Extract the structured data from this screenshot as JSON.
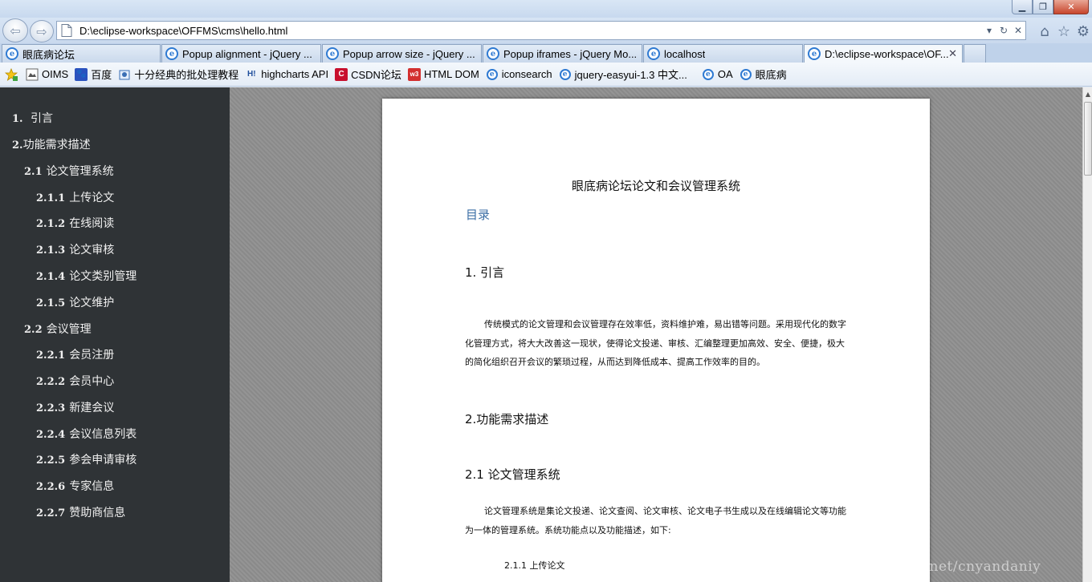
{
  "browser": {
    "address": "D:\\eclipse-workspace\\OFFMS\\cms\\hello.html",
    "tabs": [
      {
        "label": "眼底病论坛"
      },
      {
        "label": "Popup alignment - jQuery ..."
      },
      {
        "label": "Popup arrow size - jQuery ..."
      },
      {
        "label": "Popup iframes - jQuery Mo..."
      },
      {
        "label": "localhost"
      },
      {
        "label": "D:\\eclipse-workspace\\OF...",
        "active": true
      }
    ],
    "favorites": [
      {
        "label": "OIMS",
        "icon": "page-icon"
      },
      {
        "label": "百度",
        "icon": "baidu-icon"
      },
      {
        "label": "十分经典的批处理教程",
        "icon": "web-slice-icon"
      },
      {
        "label": "highcharts API",
        "icon": "highcharts-icon"
      },
      {
        "label": "CSDN论坛",
        "icon": "csdn-icon"
      },
      {
        "label": "HTML DOM",
        "icon": "w3school-icon"
      },
      {
        "label": "iconsearch",
        "icon": "ie-page-icon"
      },
      {
        "label": "jquery-easyui-1.3 中文...",
        "icon": "ie-page-icon"
      },
      {
        "label": "OA",
        "icon": "ie-page-icon"
      },
      {
        "label": "眼底病",
        "icon": "ie-page-icon"
      }
    ]
  },
  "sidebar": {
    "items": [
      {
        "num": "1.",
        "label": "引言",
        "level": 0
      },
      {
        "num": "2.",
        "label": "功能需求描述",
        "level": 0
      },
      {
        "num": "2.1",
        "label": "论文管理系统",
        "level": 1
      },
      {
        "num": "2.1.1",
        "label": "上传论文",
        "level": 2
      },
      {
        "num": "2.1.2",
        "label": "在线阅读",
        "level": 2
      },
      {
        "num": "2.1.3",
        "label": "论文审核",
        "level": 2
      },
      {
        "num": "2.1.4",
        "label": "论文类别管理",
        "level": 2
      },
      {
        "num": "2.1.5",
        "label": "论文维护",
        "level": 2
      },
      {
        "num": "2.2",
        "label": "会议管理",
        "level": 1
      },
      {
        "num": "2.2.1",
        "label": "会员注册",
        "level": 2
      },
      {
        "num": "2.2.2",
        "label": "会员中心",
        "level": 2
      },
      {
        "num": "2.2.3",
        "label": "新建会议",
        "level": 2
      },
      {
        "num": "2.2.4",
        "label": "会议信息列表",
        "level": 2
      },
      {
        "num": "2.2.5",
        "label": "参会申请审核",
        "level": 2
      },
      {
        "num": "2.2.6",
        "label": "专家信息",
        "level": 2
      },
      {
        "num": "2.2.7",
        "label": "赞助商信息",
        "level": 2
      }
    ]
  },
  "document": {
    "title": "眼底病论坛论文和会议管理系统",
    "toc_link": "目录",
    "sec1_heading": "1. 引言",
    "sec1_para": "传统模式的论文管理和会议管理存在效率低，资料维护难，易出错等问题。采用现代化的数字化管理方式，将大大改善这一现状，使得论文投递、审核、汇编整理更加高效、安全、便捷，极大的简化组织召开会议的繁琐过程，从而达到降低成本、提高工作效率的目的。",
    "sec2_heading": "2.功能需求描述",
    "sec21_heading": "2.1  论文管理系统",
    "sec21_para": "论文管理系统是集论文投递、论文查阅、论文审核、论文电子书生成以及在线编辑论文等功能为一体的管理系统。系统功能点以及功能描述，如下:",
    "sec211_heading": "2.1.1 上传论文",
    "watermark": "http://blog.csdn.net/cnyandaniy"
  }
}
